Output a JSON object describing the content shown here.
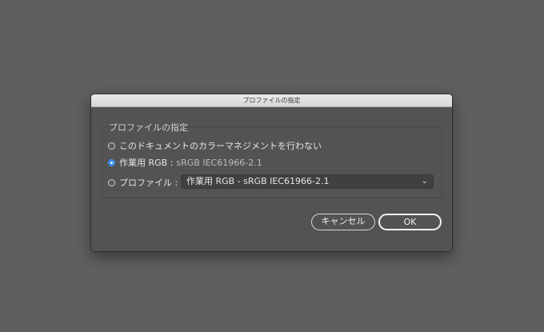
{
  "dialog": {
    "title": "プロファイルの指定",
    "group_title": "プロファイルの指定",
    "options": [
      {
        "label": "このドキュメントのカラーマネジメントを行わない",
        "selected": false
      },
      {
        "label": "作業用 RGB :",
        "value": "sRGB IEC61966-2.1",
        "selected": true
      },
      {
        "label": "プロファイル :",
        "selected": false
      }
    ],
    "profile_select": {
      "value": "作業用 RGB - sRGB IEC61966-2.1"
    },
    "buttons": {
      "cancel": "キャンセル",
      "ok": "OK"
    }
  },
  "colors": {
    "background": "#5f5f5f",
    "dialog": "#535353",
    "accent": "#2f86ea"
  }
}
